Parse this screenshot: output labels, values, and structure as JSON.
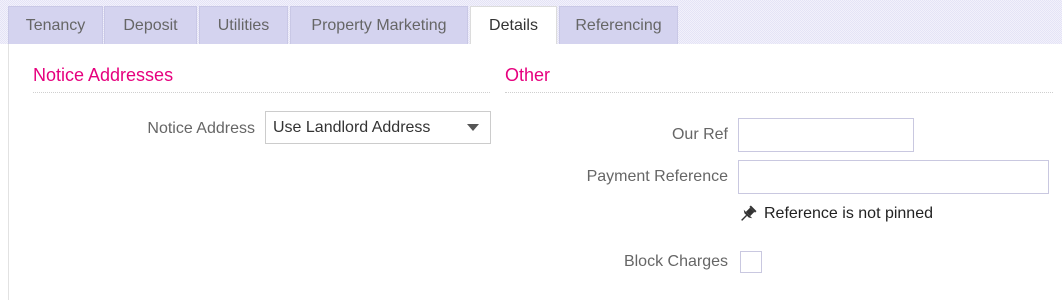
{
  "tabs": [
    {
      "label": "Tenancy"
    },
    {
      "label": "Deposit"
    },
    {
      "label": "Utilities"
    },
    {
      "label": "Property Marketing"
    },
    {
      "label": "Details"
    },
    {
      "label": "Referencing"
    }
  ],
  "active_tab": "Details",
  "notice_addresses": {
    "title": "Notice Addresses",
    "notice_address_label": "Notice Address",
    "notice_address_value": "Use Landlord Address"
  },
  "other": {
    "title": "Other",
    "our_ref_label": "Our Ref",
    "our_ref_value": "",
    "payment_reference_label": "Payment Reference",
    "payment_reference_value": "",
    "pin_status": "Reference is not pinned",
    "block_charges_label": "Block Charges",
    "block_charges_checked": false
  },
  "colors": {
    "accent": "#e6007e",
    "tab_bg": "#d4d3ef",
    "tab_active_bg": "#ffffff"
  },
  "icons": {
    "pin": "pushpin-icon",
    "dropdown": "chevron-down-icon"
  }
}
